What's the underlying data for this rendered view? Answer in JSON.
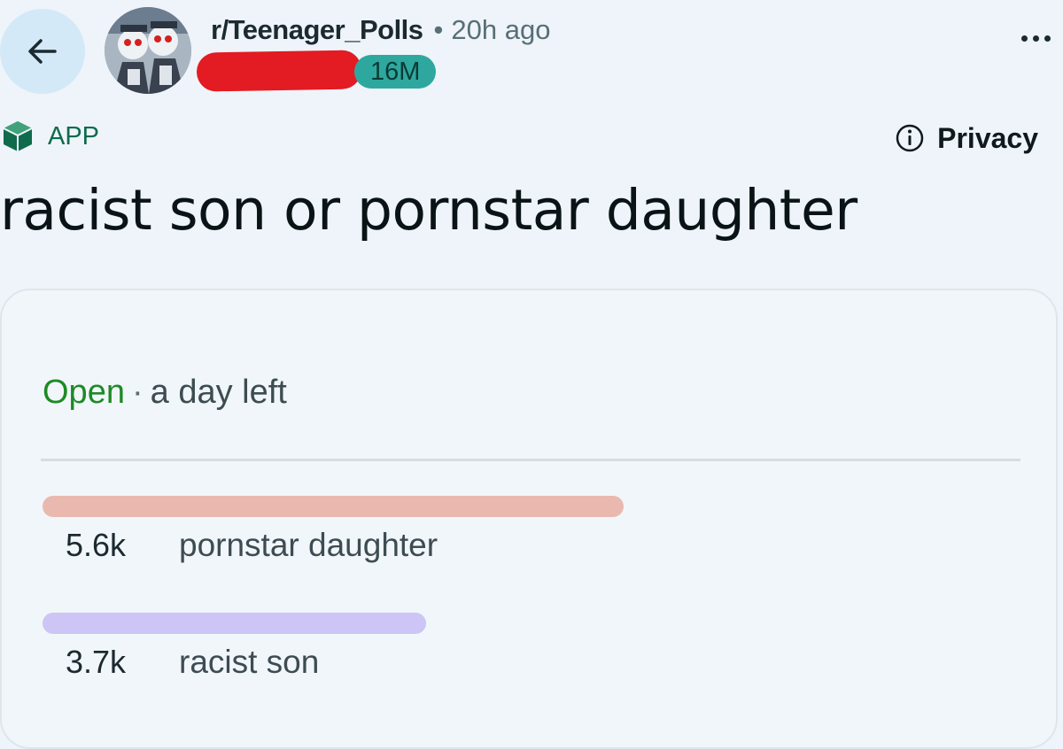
{
  "header": {
    "subreddit": "r/Teenager_Polls",
    "separator": "•",
    "time_ago": "20h ago",
    "flair": "16M",
    "redaction_color": "#e31b22"
  },
  "app_tag": {
    "label": "APP",
    "icon": "cube-icon"
  },
  "privacy": {
    "label": "Privacy",
    "icon": "info-icon"
  },
  "post": {
    "title": "racist son or pornstar daughter"
  },
  "poll": {
    "status": "Open",
    "separator": "·",
    "time_left": "a day left",
    "options": [
      {
        "count": "5.6k",
        "label": "pornstar daughter",
        "votes": 5600,
        "color": "#e9b9b0"
      },
      {
        "count": "3.7k",
        "label": "racist son",
        "votes": 3700,
        "color": "#ccc5f5"
      }
    ]
  },
  "colors": {
    "background": "#eef4f9",
    "back_button_bg": "#d3e9f7",
    "open_status": "#1e8a26",
    "app_tag": "#0e6b4c",
    "flair_bg": "#2ea89f"
  }
}
